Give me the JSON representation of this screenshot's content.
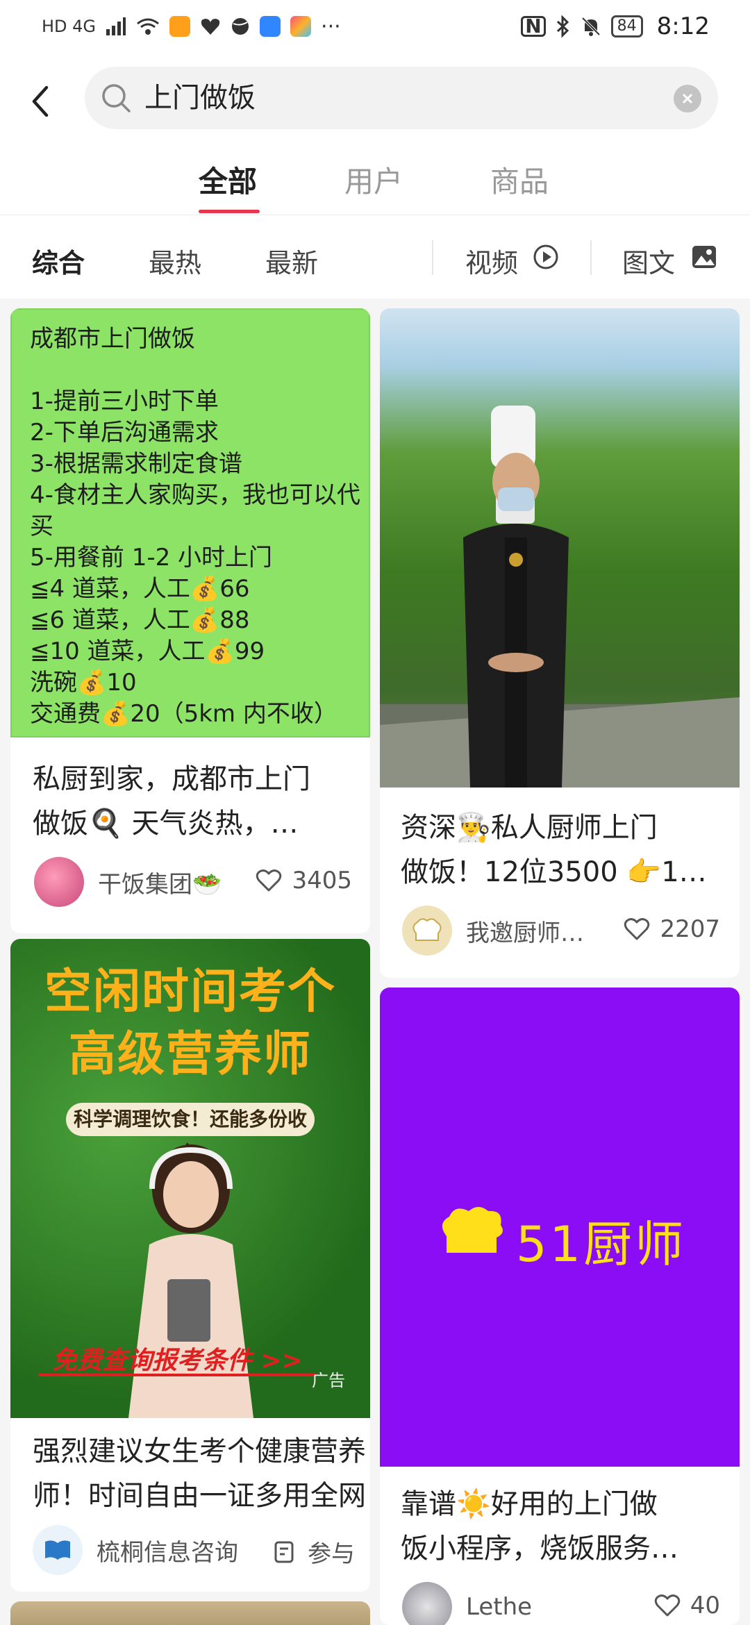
{
  "status_bar": {
    "network": "HD 4G",
    "battery": "84",
    "time": "8:12",
    "colors": {
      "app1": "#ff9f1a",
      "app2": "#2f86ff",
      "app3": "#ff4f7a"
    }
  },
  "search": {
    "query": "上门做饭"
  },
  "tabs": [
    {
      "label": "全部",
      "active": true
    },
    {
      "label": "用户",
      "active": false
    },
    {
      "label": "商品",
      "active": false
    }
  ],
  "filters": {
    "sort": [
      "综合",
      "最热",
      "最新"
    ],
    "video": "视频",
    "image_text": "图文"
  },
  "accent": "#e8364d",
  "feed": [
    {
      "image_lines": [
        "成都市上门做饭",
        "",
        "1-提前三小时下单",
        "2-下单后沟通需求",
        "3-根据需求制定食谱",
        "4-食材主人家购买，我也可以代",
        "买",
        "5-用餐前 1-2 小时上门",
        "≦4 道菜，人工💰66",
        "≦6 道菜，人工💰88",
        "≦10 道菜，人工💰99",
        "洗碗💰10",
        "交通费💰20（5km 内不收）"
      ],
      "title_line1": "私厨到家，成都市上门",
      "title_line2": "做饭🍳 天气炎热，…",
      "author": "干饭集团🥗",
      "likes": "3405"
    },
    {
      "title_line1": "资深👨‍🍳私人厨师上门",
      "title_line2": "做饭！12位3500 👉1…",
      "author": "我邀厨师…",
      "likes": "2207"
    },
    {
      "ad_headline1": "空闲时间考个",
      "ad_headline2": "高级营养师",
      "ad_sub": "科学调理饮食！还能多份收入",
      "ad_cta": "免费查询报考条件 >>",
      "ad_tag": "广告",
      "title_line1": "强烈建议女生考个健康营养",
      "title_line2": "师！时间自由一证多用全网",
      "author": "梳桐信息咨询",
      "action": "参与"
    },
    {
      "logo_text": "51厨师",
      "title_line1": "靠谱☀️好用的上门做",
      "title_line2": "饭小程序，烧饭服务…",
      "author": "Lethe",
      "likes": "40"
    }
  ]
}
